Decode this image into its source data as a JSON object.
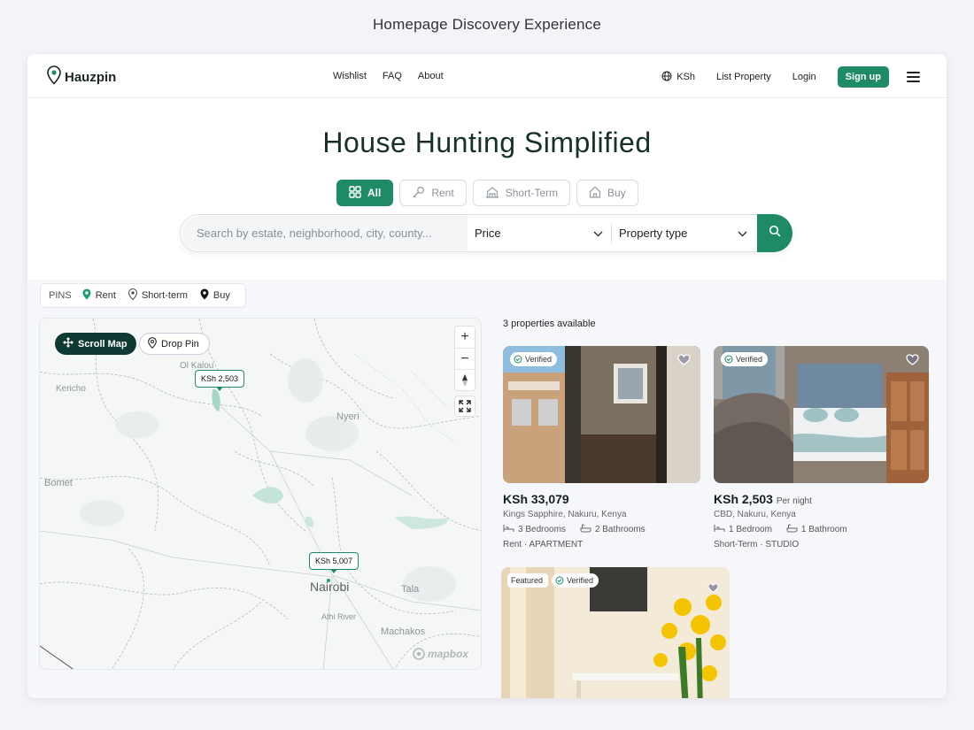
{
  "page_heading": "Homepage Discovery Experience",
  "nav": {
    "brand": "Hauzpin",
    "links": [
      "Wishlist",
      "FAQ",
      "About"
    ],
    "currency": "KSh",
    "list_property": "List Property",
    "login": "Login",
    "signup": "Sign up"
  },
  "hero": {
    "title": "House Hunting Simplified",
    "tabs": [
      {
        "label": "All",
        "icon": "grid-icon",
        "active": true
      },
      {
        "label": "Rent",
        "icon": "key-icon",
        "active": false
      },
      {
        "label": "Short-Term",
        "icon": "building-icon",
        "active": false
      },
      {
        "label": "Buy",
        "icon": "house-icon",
        "active": false
      }
    ],
    "search_placeholder": "Search by estate, neighborhood, city, county...",
    "price_label": "Price",
    "type_label": "Property type"
  },
  "pins_legend": {
    "label": "PINS",
    "items": [
      {
        "label": "Rent",
        "color": "#1e9e75"
      },
      {
        "label": "Short-term",
        "color": "#444444"
      },
      {
        "label": "Buy",
        "color": "#111111"
      }
    ]
  },
  "map": {
    "scroll_map": "Scroll Map",
    "drop_pin": "Drop Pin",
    "zoom_in": "+",
    "zoom_out": "−",
    "price_pins": [
      "KSh 2,503",
      "KSh 5,007"
    ],
    "places": [
      "Ol Kalou",
      "Kericho",
      "Nyeri",
      "Bomet",
      "Nairobi",
      "Tala",
      "Athi River",
      "Machakos"
    ],
    "attribution": "mapbox"
  },
  "listings": {
    "count_text": "3 properties available",
    "items": [
      {
        "badges": [
          "Verified"
        ],
        "price": "KSh 33,079",
        "price_suffix": "",
        "location": "Kings Sapphire, Nakuru, Kenya",
        "bedrooms": "3 Bedrooms",
        "bathrooms": "2 Bathrooms",
        "type": "Rent · APARTMENT"
      },
      {
        "badges": [
          "Verified"
        ],
        "price": "KSh 2,503",
        "price_suffix": "Per night",
        "location": "CBD, Nakuru, Kenya",
        "bedrooms": "1 Bedroom",
        "bathrooms": "1 Bathroom",
        "type": "Short-Term · STUDIO"
      },
      {
        "badges": [
          "Featured",
          "Verified"
        ]
      }
    ]
  },
  "colors": {
    "brand_green": "#1e8a66",
    "dark_green": "#0f3a33"
  }
}
